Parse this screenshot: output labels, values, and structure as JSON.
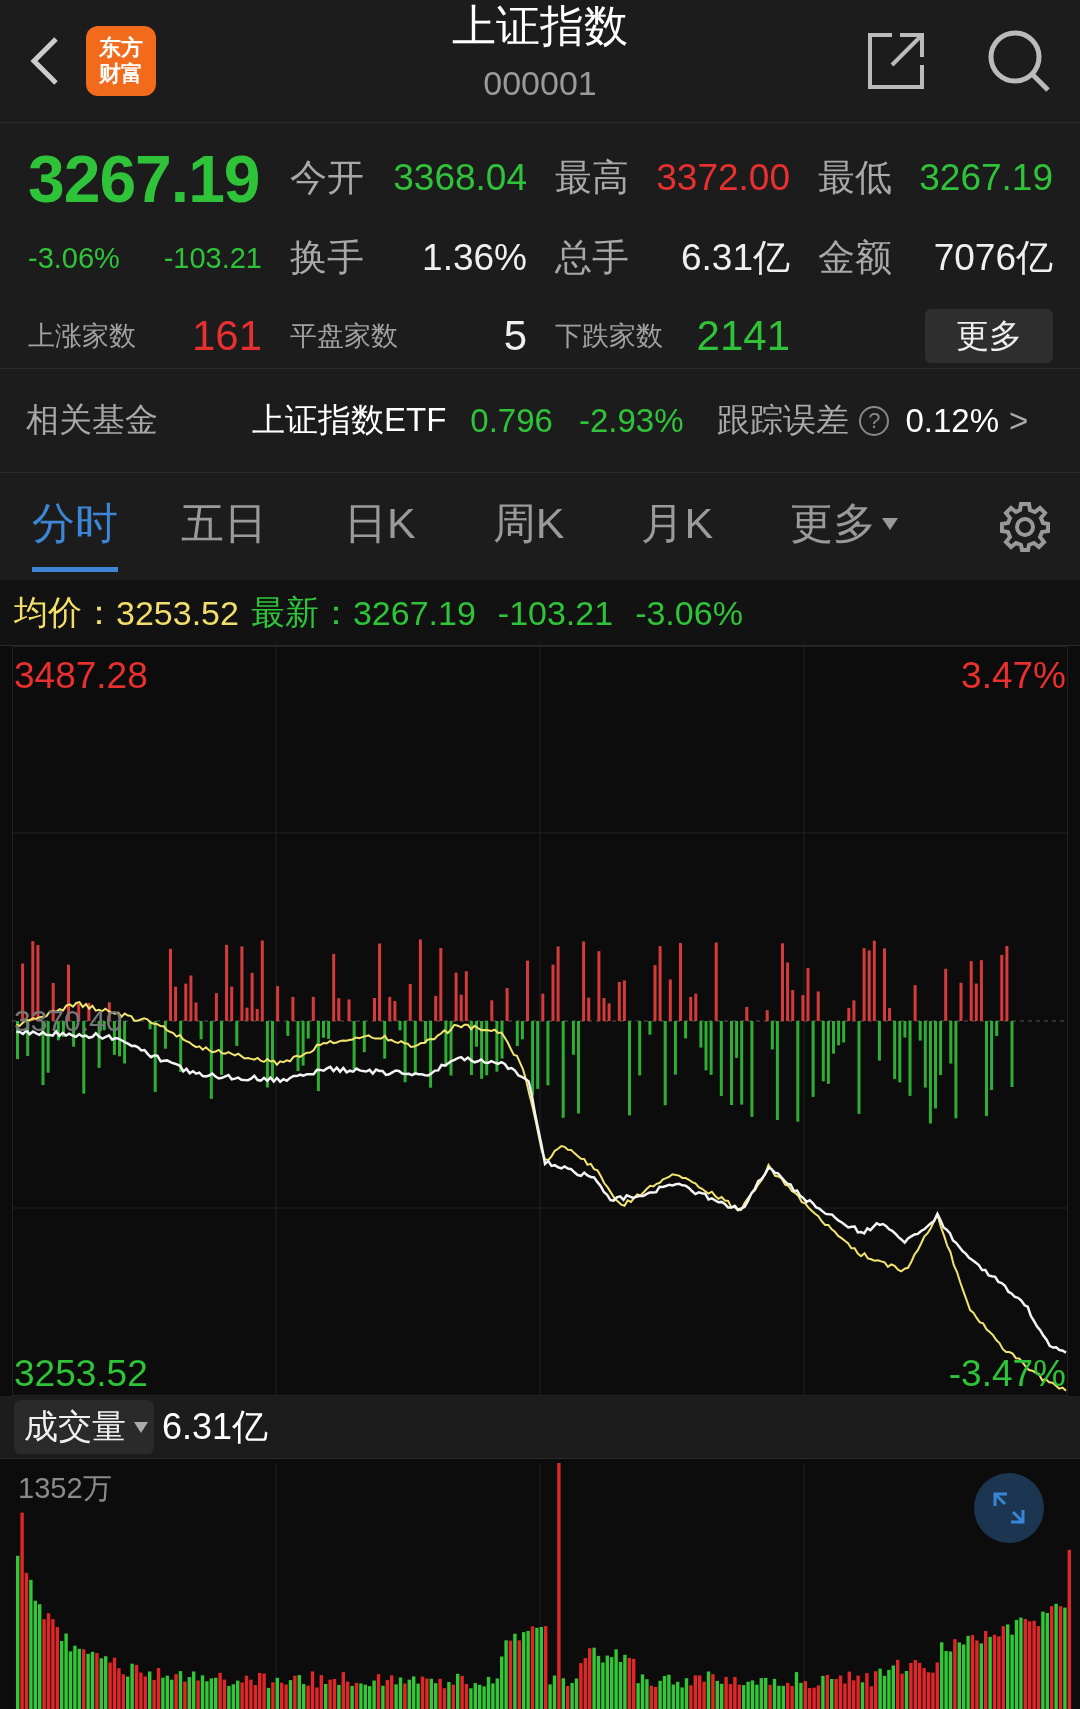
{
  "header": {
    "logo": [
      "东方",
      "财富"
    ],
    "title": "上证指数",
    "code": "000001"
  },
  "quote": {
    "price": "3267.19",
    "change_pct": "-3.06%",
    "change": "-103.21",
    "color": "#2fc33a",
    "stats": [
      {
        "label": "今开",
        "value": "3368.04",
        "color": "#2fc33a"
      },
      {
        "label": "最高",
        "value": "3372.00",
        "color": "#e8302f"
      },
      {
        "label": "最低",
        "value": "3267.19",
        "color": "#2fc33a"
      },
      {
        "label": "换手",
        "value": "1.36%",
        "color": "#f0f0f0"
      },
      {
        "label": "总手",
        "value": "6.31亿",
        "color": "#f0f0f0"
      },
      {
        "label": "金额",
        "value": "7076亿",
        "color": "#f0f0f0"
      }
    ],
    "breadth": [
      {
        "label": "上涨家数",
        "value": "161",
        "color": "#e8302f"
      },
      {
        "label": "平盘家数",
        "value": "5",
        "color": "#f0f0f0"
      },
      {
        "label": "下跌家数",
        "value": "2141",
        "color": "#2fc33a"
      }
    ],
    "more_button": "更多"
  },
  "fund": {
    "label": "相关基金",
    "name": "上证指数ETF",
    "price": "0.796",
    "change": "-2.93%",
    "color": "#2fc33a",
    "tracking_label": "跟踪误差",
    "help": "?",
    "tracking_value": "0.12%",
    "arrow": ">"
  },
  "tabs": [
    {
      "label": "分时",
      "selected": true,
      "kind": "tab"
    },
    {
      "label": "五日",
      "selected": false,
      "kind": "tab"
    },
    {
      "label": "日K",
      "selected": false,
      "kind": "tab"
    },
    {
      "label": "周K",
      "selected": false,
      "kind": "tab"
    },
    {
      "label": "月K",
      "selected": false,
      "kind": "tab"
    },
    {
      "label": "更多",
      "selected": false,
      "kind": "dropdown"
    }
  ],
  "info": {
    "avg_label": "均价：",
    "avg": "3253.52",
    "latest_label": "最新：",
    "latest": "3267.19",
    "change": "-103.21",
    "change_pct": "-3.06%"
  },
  "chart": {
    "top_price": "3487.28",
    "top_pct": "3.47%",
    "mid_price": "3370.40",
    "bottom_price": "3253.52",
    "bottom_pct": "-3.47%"
  },
  "volume": {
    "selector": "成交量",
    "total": "6.31亿",
    "max_label": "1352万"
  }
}
